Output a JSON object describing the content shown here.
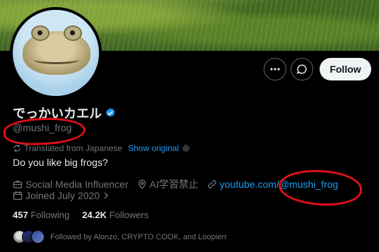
{
  "banner": {
    "icon": "grass-field-image"
  },
  "avatar": {
    "icon": "frog-avatar-image"
  },
  "actions": {
    "more_icon": "more-horizontal-icon",
    "message_icon": "message-bubble-icon",
    "follow_label": "Follow"
  },
  "profile": {
    "display_name": "でっかいカエル",
    "verified_icon": "verified-badge-icon",
    "handle": "@mushi_frog",
    "translated_label": "Translated from Japanese",
    "show_original": "Show original",
    "bio": "Do you like big frogs?",
    "category": "Social Media Influencer",
    "location": "AI学習禁止",
    "website": "youtube.com/@mushi_frog",
    "joined": "Joined July 2020"
  },
  "stats": {
    "following_count": "457",
    "following_label": "Following",
    "followers_count": "24.2K",
    "followers_label": "Followers"
  },
  "followed_by": "Followed by Alonzo, CRYPTO COOK, and Loopierr",
  "colors": {
    "accent": "#1d9bf0",
    "annotation": "#e0101a",
    "background": "#000000"
  }
}
